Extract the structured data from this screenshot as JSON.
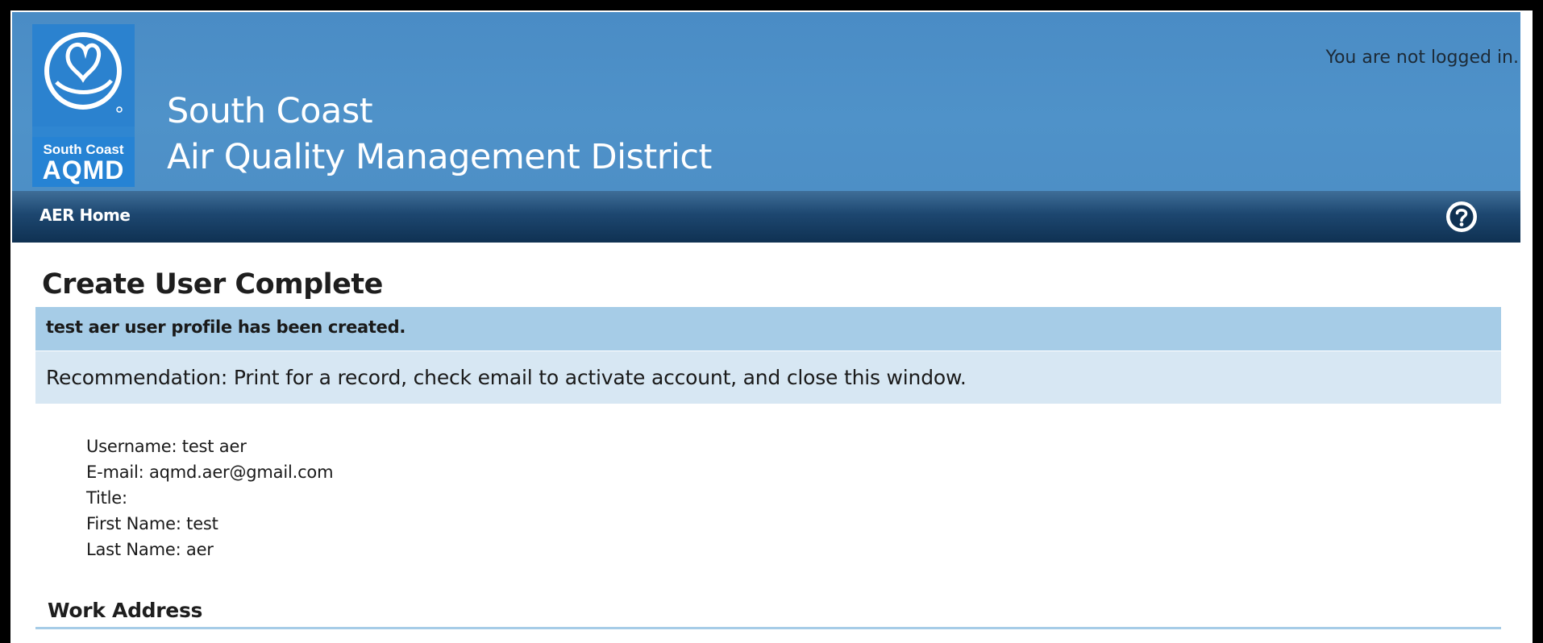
{
  "header": {
    "logo": {
      "small_text": "South Coast",
      "big_text": "AQMD",
      "icon": "aqmd-seal-icon"
    },
    "org_name_line1": "South Coast",
    "org_name_line2": "Air Quality Management District",
    "login_status": "You are not logged in."
  },
  "nav": {
    "home_label": "AER Home",
    "help_icon": "help-circle-icon"
  },
  "main": {
    "title": "Create User Complete",
    "success_message": "test aer user profile has been created.",
    "recommendation": "Recommendation: Print for a record, check email to activate account, and close this window.",
    "details": [
      "Username: test aer",
      "E-mail: aqmd.aer@gmail.com",
      "Title:",
      "First Name: test",
      "Last Name: aer"
    ],
    "section_heading": "Work Address"
  },
  "colors": {
    "header_blue": "#4d8fc6",
    "logo_blue": "#2b82cf",
    "nav_dark": "#1d4770",
    "success_bg": "#a6cce7",
    "recommendation_bg": "#d7e7f3"
  }
}
